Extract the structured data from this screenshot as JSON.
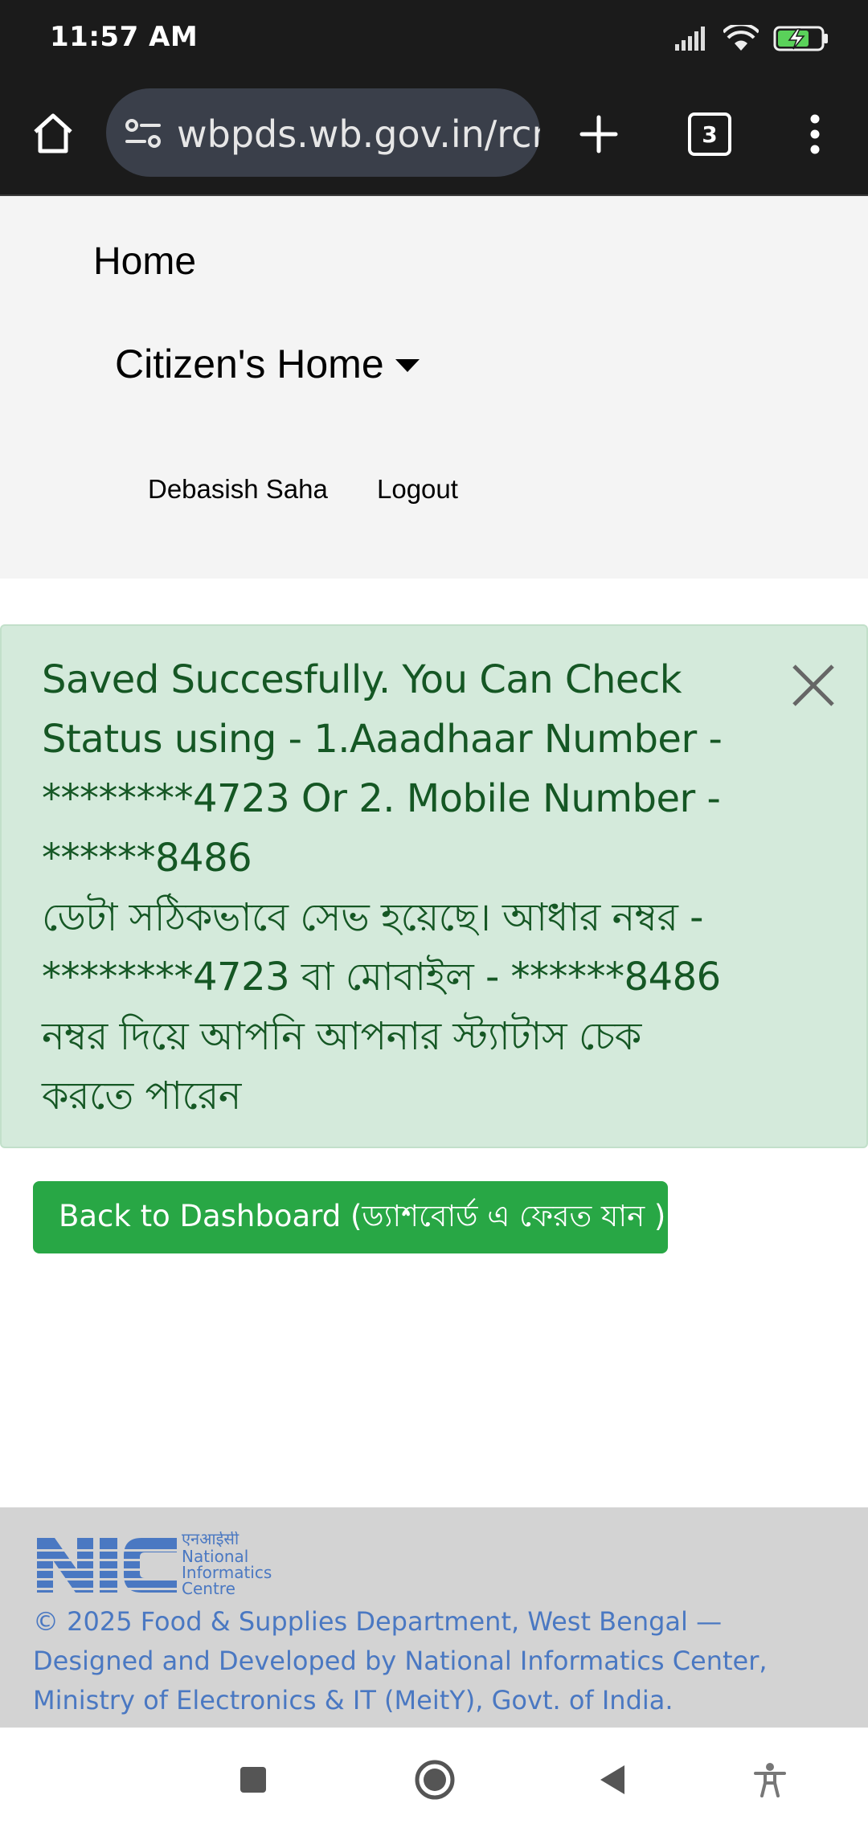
{
  "status_bar": {
    "time": "11:57 AM",
    "icons": [
      "signal-icon",
      "wifi-icon",
      "battery-charging-icon"
    ]
  },
  "browser": {
    "url": "wbpds.wb.gov.in/rcm",
    "tab_count": "3",
    "icons": [
      "home-icon",
      "site-info-icon",
      "new-tab-icon",
      "tab-switcher-icon",
      "more-menu-icon"
    ]
  },
  "nav": {
    "home": "Home",
    "citizen_home": "Citizen's Home",
    "user_name": "Debasish Saha",
    "logout": "Logout"
  },
  "alert": {
    "lines_en": [
      "Saved Succesfully. You Can Check",
      "Status using - 1.Aaadhaar Number -",
      "********4723 Or 2. Mobile Number -",
      "******8486"
    ],
    "lines_bn": [
      "ডেটা সঠিকভাবে সেভ হয়েছে। আধার নম্বর -",
      "********4723 বা মোবাইল - ******8486",
      "নম্বর দিয়ে আপনি আপনার স্ট্যাটাস চেক",
      "করতে পারেন"
    ],
    "color_bg": "#d4eadb",
    "color_text": "#155724"
  },
  "back_button": {
    "label": "Back to Dashboard (ড্যাশবোর্ড এ ফেরত যান )",
    "color": "#28a745"
  },
  "footer": {
    "logo_hindi": "एनआईसी",
    "logo_lines": [
      "National",
      "Informatics",
      "Centre"
    ],
    "text": "© 2025 Food & Supplies Department, West Bengal — Designed and Developed by National Informatics Center, Ministry of Electronics & IT (MeitY), Govt. of India.",
    "link_color": "#4a78c2"
  },
  "system_nav": {
    "icons": [
      "recents-icon",
      "home-circle-icon",
      "back-icon",
      "accessibility-icon"
    ]
  }
}
